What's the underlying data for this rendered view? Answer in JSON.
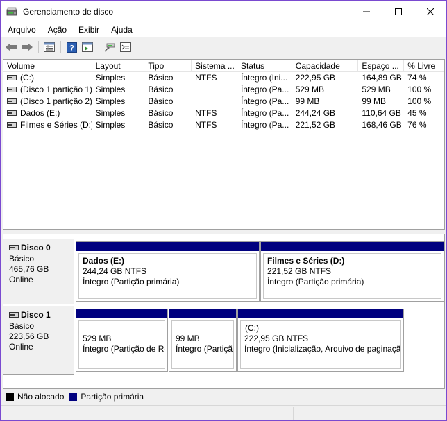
{
  "window": {
    "title": "Gerenciamento de disco"
  },
  "menu": [
    "Arquivo",
    "Ação",
    "Exibir",
    "Ajuda"
  ],
  "toolbar": [
    "back-icon",
    "forward-icon",
    "properties-icon",
    "help-icon",
    "view-icon",
    "connect-icon",
    "console-icon"
  ],
  "columns": [
    "Volume",
    "Layout",
    "Tipo",
    "Sistema ...",
    "Status",
    "Capacidade",
    "Espaço ...",
    "% Livre"
  ],
  "volumes": [
    {
      "volume": "(C:)",
      "layout": "Simples",
      "tipo": "Básico",
      "fs": "NTFS",
      "status": "Íntegro (Ini...",
      "cap": "222,95 GB",
      "free": "164,89 GB",
      "pct": "74 %"
    },
    {
      "volume": "(Disco 1 partição 1)",
      "layout": "Simples",
      "tipo": "Básico",
      "fs": "",
      "status": "Íntegro (Pa...",
      "cap": "529 MB",
      "free": "529 MB",
      "pct": "100 %"
    },
    {
      "volume": "(Disco 1 partição 2)",
      "layout": "Simples",
      "tipo": "Básico",
      "fs": "",
      "status": "Íntegro (Pa...",
      "cap": "99 MB",
      "free": "99 MB",
      "pct": "100 %"
    },
    {
      "volume": "Dados (E:)",
      "layout": "Simples",
      "tipo": "Básico",
      "fs": "NTFS",
      "status": "Íntegro (Pa...",
      "cap": "244,24 GB",
      "free": "110,64 GB",
      "pct": "45 %"
    },
    {
      "volume": "Filmes e Séries (D:)",
      "layout": "Simples",
      "tipo": "Básico",
      "fs": "NTFS",
      "status": "Íntegro (Pa...",
      "cap": "221,52 GB",
      "free": "168,46 GB",
      "pct": "76 %"
    }
  ],
  "disks": [
    {
      "name": "Disco 0",
      "type": "Básico",
      "size": "465,76 GB",
      "state": "Online",
      "partitions": [
        {
          "title": "Dados  (E:)",
          "size": "244,24 GB NTFS",
          "status": "Íntegro (Partição primária)"
        },
        {
          "title": "Filmes e Séries  (D:)",
          "size": "221,52 GB NTFS",
          "status": "Íntegro (Partição primária)"
        }
      ]
    },
    {
      "name": "Disco 1",
      "type": "Básico",
      "size": "223,56 GB",
      "state": "Online",
      "partitions": [
        {
          "title": "",
          "size": "529 MB",
          "status": "Íntegro (Partição de Re"
        },
        {
          "title": "",
          "size": "99 MB",
          "status": "Íntegro (Partiçã"
        },
        {
          "title": "(C:)",
          "size": "222,95 GB NTFS",
          "status": "Íntegro (Inicialização, Arquivo de paginação, De"
        }
      ]
    }
  ],
  "legend": [
    {
      "label": "Não alocado",
      "color": "#000000"
    },
    {
      "label": "Partição primária",
      "color": "#00007f"
    }
  ],
  "colors": {
    "primary_partition": "#00007f",
    "window_border": "#7a4ad0"
  }
}
